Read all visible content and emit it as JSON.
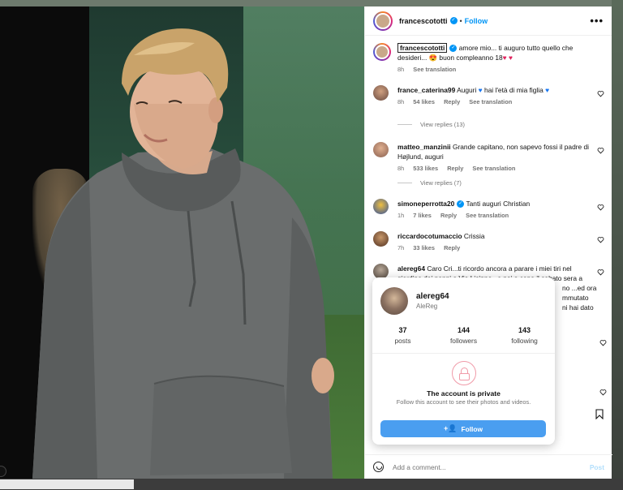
{
  "post": {
    "author": "francescototti",
    "follow_label": "Follow",
    "dot": "•",
    "more": "•••"
  },
  "caption": {
    "username": "francescototti",
    "text_line1": "amore mio... ti auguro tutto quello che",
    "text_line2": "desideri... ",
    "text_emoji1": "😍",
    "text_line2b": " buon compleanno 18",
    "hearts": "♥ ♥",
    "time": "8h",
    "see_translation": "See translation"
  },
  "comments": [
    {
      "username": "france_caterina99",
      "text": "Auguri ",
      "text_b": " hai l'età di mia figlia ",
      "time": "8h",
      "likes": "54 likes",
      "reply": "Reply",
      "see_translation": "See translation",
      "view_replies": "View replies (13)"
    },
    {
      "username": "matteo_manzinii",
      "text": "Grande capitano, non sapevo fossi il padre di Højlund, auguri",
      "time": "8h",
      "likes": "533 likes",
      "reply": "Reply",
      "see_translation": "See translation",
      "view_replies": "View replies (7)"
    },
    {
      "username": "simoneperrotta20",
      "text": "Tanti auguri Christian",
      "time": "1h",
      "likes": "7 likes",
      "reply": "Reply",
      "see_translation": "See translation"
    },
    {
      "username": "riccardocotumaccio",
      "text": "Crissia",
      "time": "7h",
      "likes": "33 likes",
      "reply": "Reply"
    },
    {
      "username": "alereg64",
      "text": "Caro Cri...ti ricordo ancora a parare i miei tiri nel giardino dei nonni a Via Lisippo...e poi a cena il sabato sera a",
      "tail1": "no ...ed ora",
      "tail2": "mmutato",
      "tail3": "ni hai dato"
    }
  ],
  "add_comment": {
    "placeholder": "Add a comment...",
    "post_label": "Post"
  },
  "hovercard": {
    "username": "alereg64",
    "full_name": "AleReg",
    "stats": [
      {
        "value": "37",
        "label": "posts"
      },
      {
        "value": "144",
        "label": "followers"
      },
      {
        "value": "143",
        "label": "following"
      }
    ],
    "private_title": "The account is private",
    "private_sub": "Follow this account to see their photos and videos.",
    "follow_label": "Follow",
    "follow_icon": "+👤"
  },
  "colors": {
    "accent": "#0095f6",
    "follow_button": "#4a9ef0",
    "heart_red": "#e0245e"
  }
}
